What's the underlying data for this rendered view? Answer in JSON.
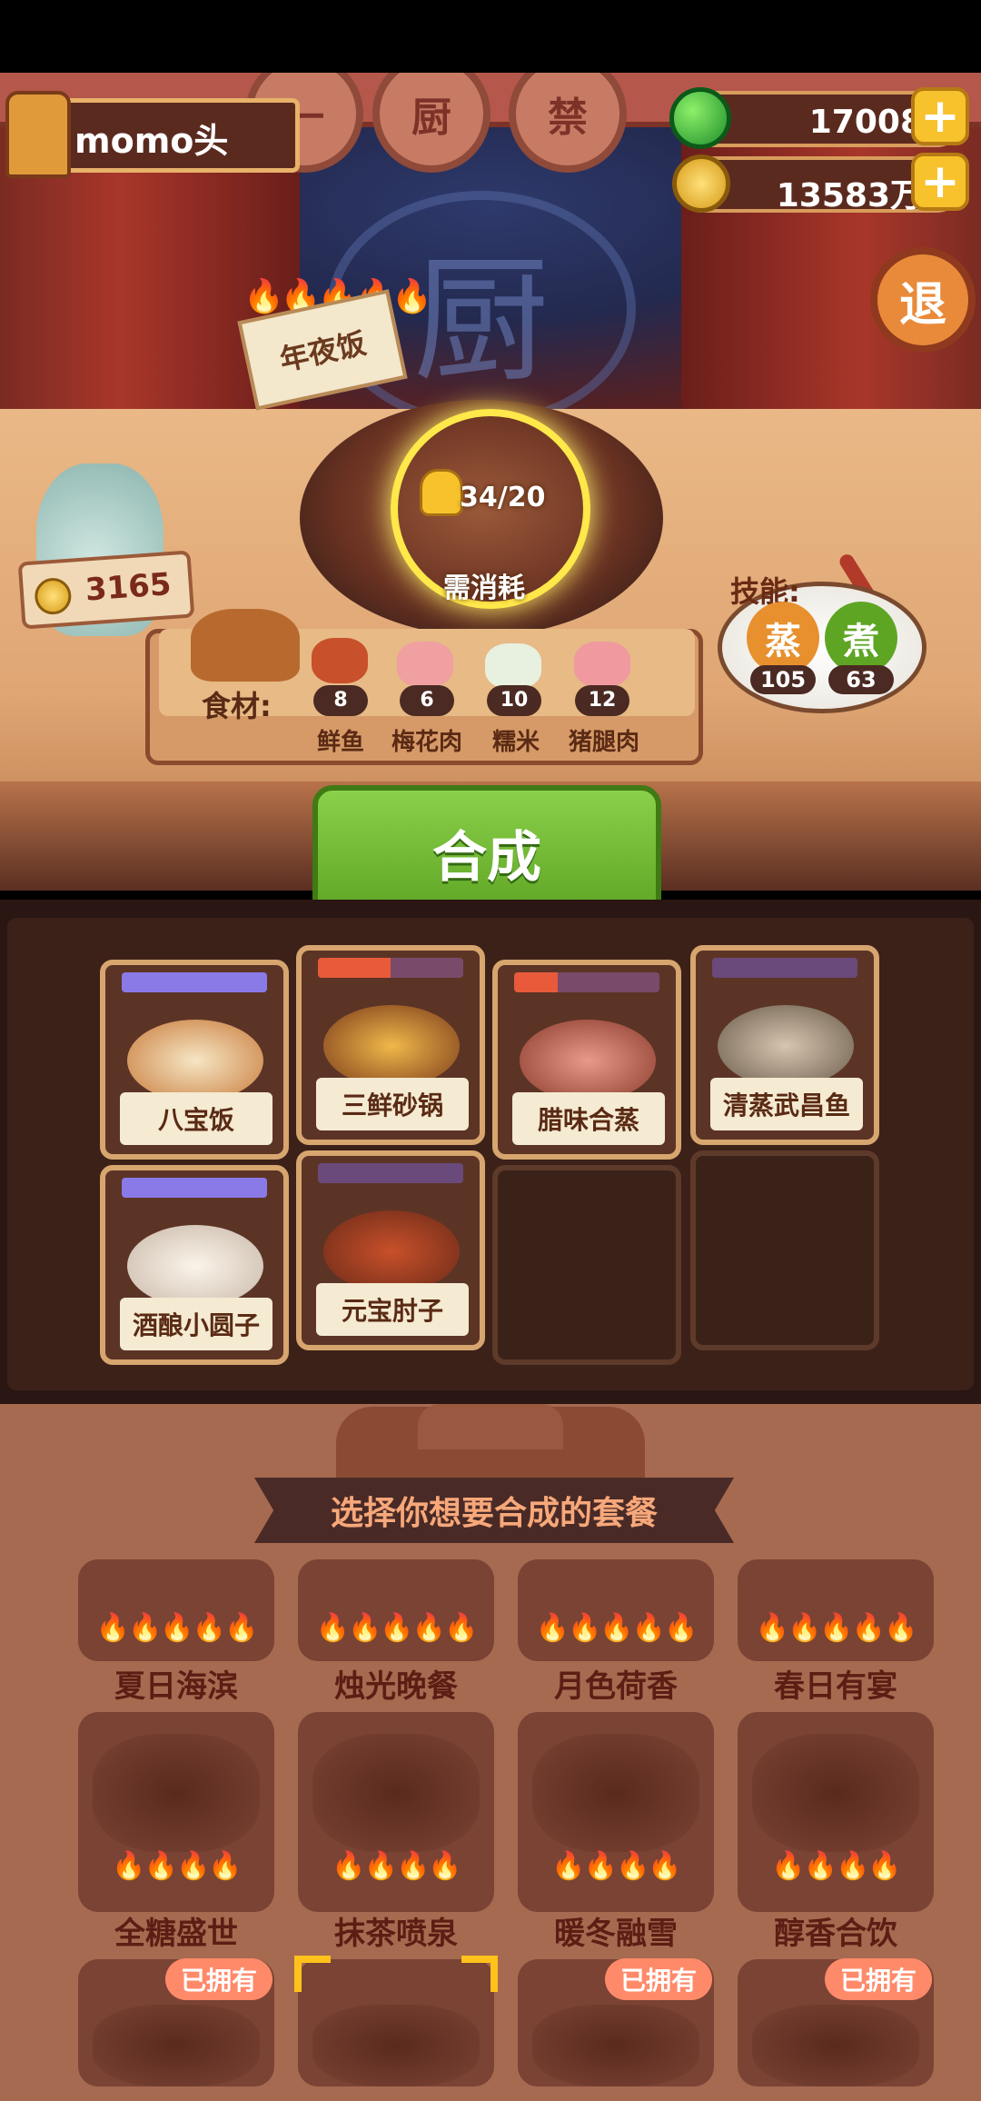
{
  "player": {
    "name": "momo头"
  },
  "resources": {
    "gems": "17008",
    "coins": "13583万"
  },
  "header": {
    "discs": [
      "一",
      "厨",
      "禁"
    ],
    "exit_label": "退"
  },
  "dish": {
    "sign": "年夜饭",
    "flames": "🔥🔥🔥🔥🔥",
    "cost": "34/20",
    "consume_label": "需消耗"
  },
  "jar": {
    "coins": "3165"
  },
  "ingredients": {
    "label": "食材:",
    "items": [
      {
        "name": "鲜鱼",
        "count": "8"
      },
      {
        "name": "梅花肉",
        "count": "6"
      },
      {
        "name": "糯米",
        "count": "10"
      },
      {
        "name": "猪腿肉",
        "count": "12"
      }
    ]
  },
  "skills": {
    "label": "技能:",
    "items": [
      {
        "name": "蒸",
        "level": "105"
      },
      {
        "name": "煮",
        "level": "63"
      }
    ]
  },
  "combine_label": "合成",
  "slots": [
    {
      "name": "八宝饭"
    },
    {
      "name": "三鲜砂锅"
    },
    {
      "name": "腊味合蒸"
    },
    {
      "name": "清蒸武昌鱼"
    },
    {
      "name": "酒酿小圆子"
    },
    {
      "name": "元宝肘子"
    }
  ],
  "select_title": "选择你想要合成的套餐",
  "sets": {
    "row1": [
      "夏日海滨",
      "烛光晚餐",
      "月色荷香",
      "春日有宴"
    ],
    "row2": [
      "全糖盛世",
      "抹茶喷泉",
      "暖冬融雪",
      "醇香合饮"
    ],
    "flames5": "🔥🔥🔥🔥🔥",
    "flames4": "🔥🔥🔥🔥",
    "owned_label": "已拥有"
  },
  "colors": {
    "accent_green": "#6cb52e",
    "gold": "#f7c22c",
    "brown": "#5b2a1f"
  }
}
